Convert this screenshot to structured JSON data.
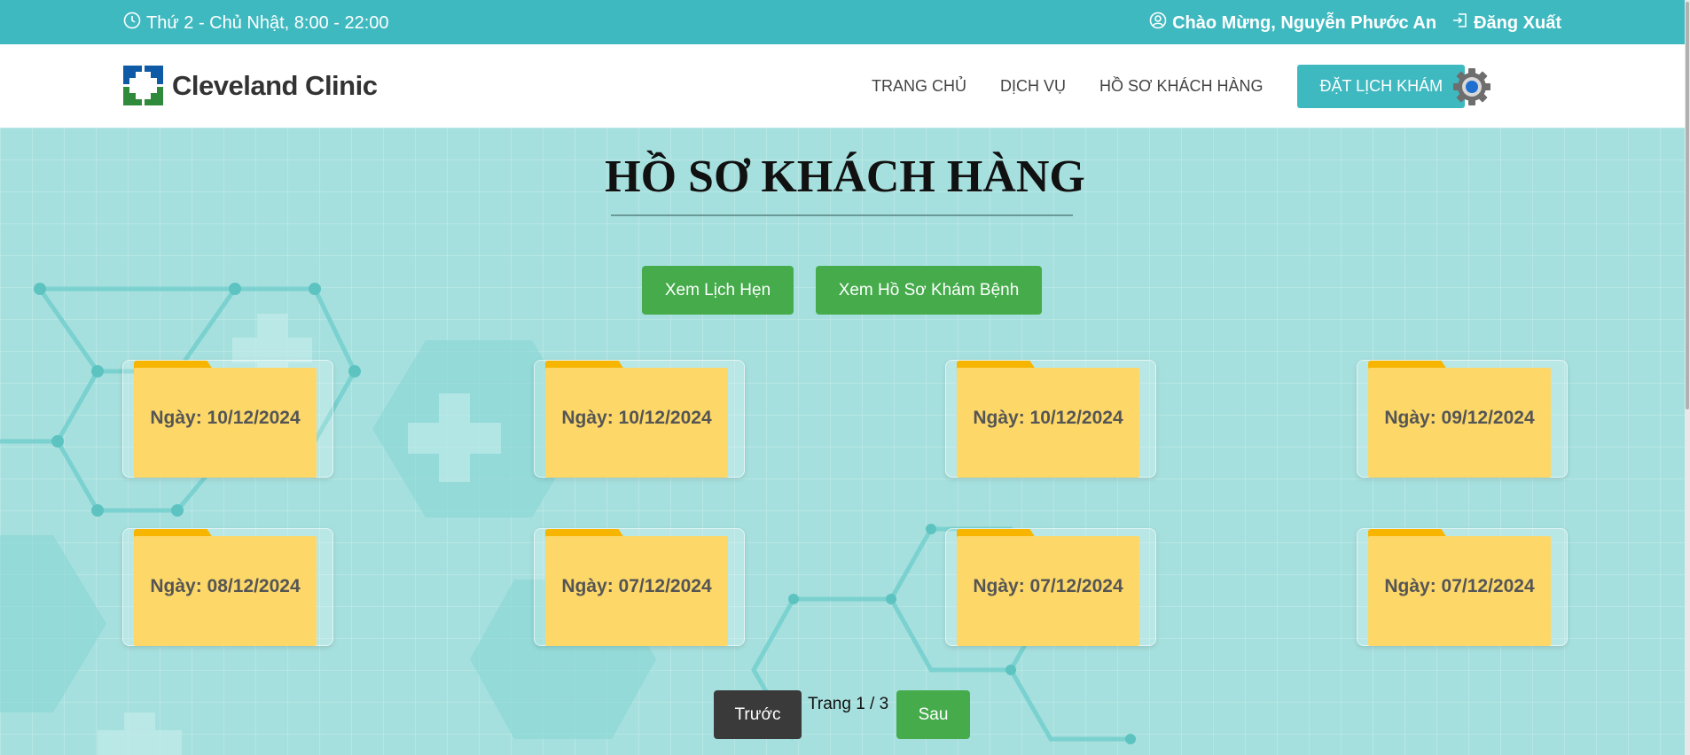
{
  "topbar": {
    "hours": "Thứ 2 - Chủ Nhật, 8:00 - 22:00",
    "greeting": "Chào Mừng, Nguyễn Phước An",
    "logout": "Đăng Xuất"
  },
  "brand": {
    "name": "Cleveland Clinic"
  },
  "nav": {
    "items": [
      "TRANG CHỦ",
      "DỊCH VỤ",
      "HỒ SƠ KHÁCH HÀNG"
    ],
    "book": "ĐẶT LỊCH KHÁM"
  },
  "page": {
    "title": "HỒ SƠ KHÁCH HÀNG",
    "view_appointments": "Xem Lịch Hẹn",
    "view_records": "Xem Hồ Sơ Khám Bệnh"
  },
  "records": [
    "Ngày: 10/12/2024",
    "Ngày: 10/12/2024",
    "Ngày: 10/12/2024",
    "Ngày: 09/12/2024",
    "Ngày: 08/12/2024",
    "Ngày: 07/12/2024",
    "Ngày: 07/12/2024",
    "Ngày: 07/12/2024"
  ],
  "pagination": {
    "prev": "Trước",
    "info": "Trang 1 / 3",
    "next": "Sau"
  },
  "colors": {
    "teal": "#3fb9c0",
    "green": "#45ab4b",
    "folder": "#fdd868",
    "folder_tab": "#f7b500"
  }
}
